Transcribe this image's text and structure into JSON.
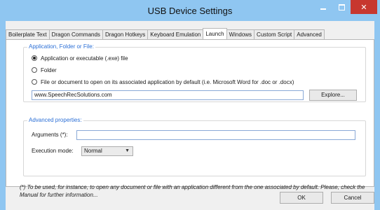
{
  "window": {
    "title": "USB Device Settings",
    "buttons": {
      "minimize": "minimize",
      "maximize": "maximize",
      "close": "✕"
    }
  },
  "tabs": [
    {
      "label": "Boilerplate Text"
    },
    {
      "label": "Dragon Commands"
    },
    {
      "label": "Dragon Hotkeys"
    },
    {
      "label": "Keyboard Emulation"
    },
    {
      "label": "Launch",
      "active": true
    },
    {
      "label": "Windows"
    },
    {
      "label": "Custom Script"
    },
    {
      "label": "Advanced"
    }
  ],
  "launch": {
    "group_title": "Application, Folder or File:",
    "options": [
      {
        "label": "Application or executable (.exe) file",
        "selected": true
      },
      {
        "label": "Folder",
        "selected": false
      },
      {
        "label": "File or document to open on its associated application by default (i.e. Microsoft Word for .doc or .docx)",
        "selected": false
      }
    ],
    "path_value": "www.SpeechRecSolutions.com",
    "explore_label": "Explore..."
  },
  "advanced": {
    "group_title": "Advanced properties:",
    "arguments_label": "Arguments (*):",
    "arguments_value": "",
    "execution_label": "Execution mode:",
    "execution_value": "Normal"
  },
  "note": "(*) To be used, for instance, to open any document or file with an application different from the one associated by default. Please, check the Manual for further information...",
  "footer": {
    "ok_label": "OK",
    "cancel_label": "Cancel"
  },
  "colors": {
    "frame": "#8fc6f1",
    "close": "#c7372f",
    "accent": "#2b6fd6"
  }
}
